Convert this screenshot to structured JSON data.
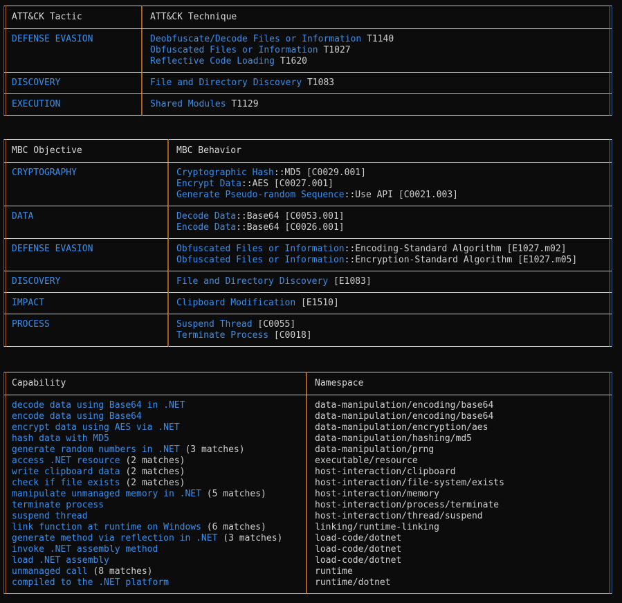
{
  "theme": {
    "background": "#0c0c0c",
    "accent_blue": "#3b8eea",
    "plain_text": "#cfcfcf",
    "header_text": "#d7d7d7",
    "border": "#c8c8c8",
    "stripe_blue": "#3f5f8f",
    "stripe_orange": "#b5651d"
  },
  "attack_table": {
    "headers": [
      "ATT&CK Tactic",
      "ATT&CK Technique"
    ],
    "rows": [
      {
        "tactic": "DEFENSE EVASION",
        "techniques": [
          {
            "name": "Deobfuscate/Decode Files or Information",
            "id": "T1140"
          },
          {
            "name": "Obfuscated Files or Information",
            "id": "T1027"
          },
          {
            "name": "Reflective Code Loading",
            "id": "T1620"
          }
        ]
      },
      {
        "tactic": "DISCOVERY",
        "techniques": [
          {
            "name": "File and Directory Discovery",
            "id": "T1083"
          }
        ]
      },
      {
        "tactic": "EXECUTION",
        "techniques": [
          {
            "name": "Shared Modules",
            "id": "T1129"
          }
        ]
      }
    ]
  },
  "mbc_table": {
    "headers": [
      "MBC Objective",
      "MBC Behavior"
    ],
    "rows": [
      {
        "objective": "CRYPTOGRAPHY",
        "behaviors": [
          {
            "name": "Cryptographic Hash",
            "detail": "::MD5 [C0029.001]"
          },
          {
            "name": "Encrypt Data",
            "detail": "::AES [C0027.001]"
          },
          {
            "name": "Generate Pseudo-random Sequence",
            "detail": "::Use API [C0021.003]"
          }
        ]
      },
      {
        "objective": "DATA",
        "behaviors": [
          {
            "name": "Decode Data",
            "detail": "::Base64 [C0053.001]"
          },
          {
            "name": "Encode Data",
            "detail": "::Base64 [C0026.001]"
          }
        ]
      },
      {
        "objective": "DEFENSE EVASION",
        "behaviors": [
          {
            "name": "Obfuscated Files or Information",
            "detail": "::Encoding-Standard Algorithm [E1027.m02]"
          },
          {
            "name": "Obfuscated Files or Information",
            "detail": "::Encryption-Standard Algorithm [E1027.m05]"
          }
        ]
      },
      {
        "objective": "DISCOVERY",
        "behaviors": [
          {
            "name": "File and Directory Discovery",
            "detail": " [E1083]"
          }
        ]
      },
      {
        "objective": "IMPACT",
        "behaviors": [
          {
            "name": "Clipboard Modification",
            "detail": " [E1510]"
          }
        ]
      },
      {
        "objective": "PROCESS",
        "behaviors": [
          {
            "name": "Suspend Thread",
            "detail": " [C0055]"
          },
          {
            "name": "Terminate Process",
            "detail": " [C0018]"
          }
        ]
      }
    ]
  },
  "capability_table": {
    "headers": [
      "Capability",
      "Namespace"
    ],
    "rows": [
      {
        "capability": "decode data using Base64 in .NET",
        "matches": "",
        "namespace": "data-manipulation/encoding/base64"
      },
      {
        "capability": "encode data using Base64",
        "matches": "",
        "namespace": "data-manipulation/encoding/base64"
      },
      {
        "capability": "encrypt data using AES via .NET",
        "matches": "",
        "namespace": "data-manipulation/encryption/aes"
      },
      {
        "capability": "hash data with MD5",
        "matches": "",
        "namespace": "data-manipulation/hashing/md5"
      },
      {
        "capability": "generate random numbers in .NET",
        "matches": " (3 matches)",
        "namespace": "data-manipulation/prng"
      },
      {
        "capability": "access .NET resource",
        "matches": " (2 matches)",
        "namespace": "executable/resource"
      },
      {
        "capability": "write clipboard data",
        "matches": " (2 matches)",
        "namespace": "host-interaction/clipboard"
      },
      {
        "capability": "check if file exists",
        "matches": " (2 matches)",
        "namespace": "host-interaction/file-system/exists"
      },
      {
        "capability": "manipulate unmanaged memory in .NET",
        "matches": " (5 matches)",
        "namespace": "host-interaction/memory"
      },
      {
        "capability": "terminate process",
        "matches": "",
        "namespace": "host-interaction/process/terminate"
      },
      {
        "capability": "suspend thread",
        "matches": "",
        "namespace": "host-interaction/thread/suspend"
      },
      {
        "capability": "link function at runtime on Windows",
        "matches": " (6 matches)",
        "namespace": "linking/runtime-linking"
      },
      {
        "capability": "generate method via reflection in .NET",
        "matches": " (3 matches)",
        "namespace": "load-code/dotnet"
      },
      {
        "capability": "invoke .NET assembly method",
        "matches": "",
        "namespace": "load-code/dotnet"
      },
      {
        "capability": "load .NET assembly",
        "matches": "",
        "namespace": "load-code/dotnet"
      },
      {
        "capability": "unmanaged call",
        "matches": " (8 matches)",
        "namespace": "runtime"
      },
      {
        "capability": "compiled to the .NET platform",
        "matches": "",
        "namespace": "runtime/dotnet"
      }
    ]
  }
}
